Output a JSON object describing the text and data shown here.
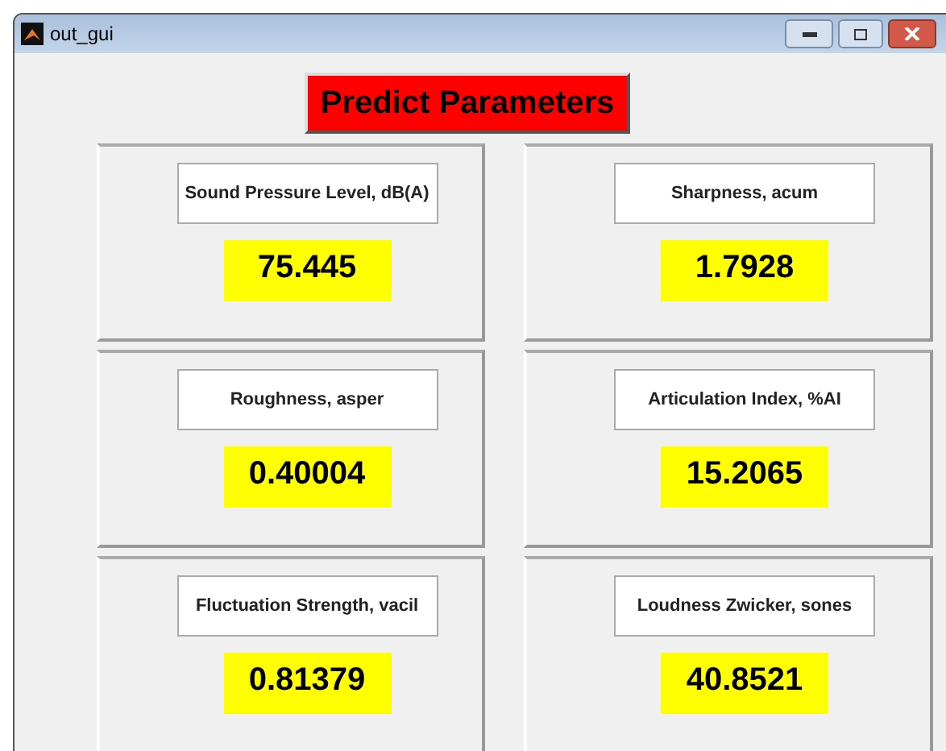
{
  "window": {
    "title": "out_gui"
  },
  "heading": "Predict Parameters",
  "panels": [
    {
      "label": "Sound Pressure Level, dB(A)",
      "value": "75.445"
    },
    {
      "label": "Sharpness, acum",
      "value": "1.7928"
    },
    {
      "label": "Roughness, asper",
      "value": "0.40004"
    },
    {
      "label": "Articulation Index, %AI",
      "value": "15.2065"
    },
    {
      "label": "Fluctuation Strength, vacil",
      "value": "0.81379"
    },
    {
      "label": "Loudness Zwicker, sones",
      "value": "40.8521"
    }
  ]
}
